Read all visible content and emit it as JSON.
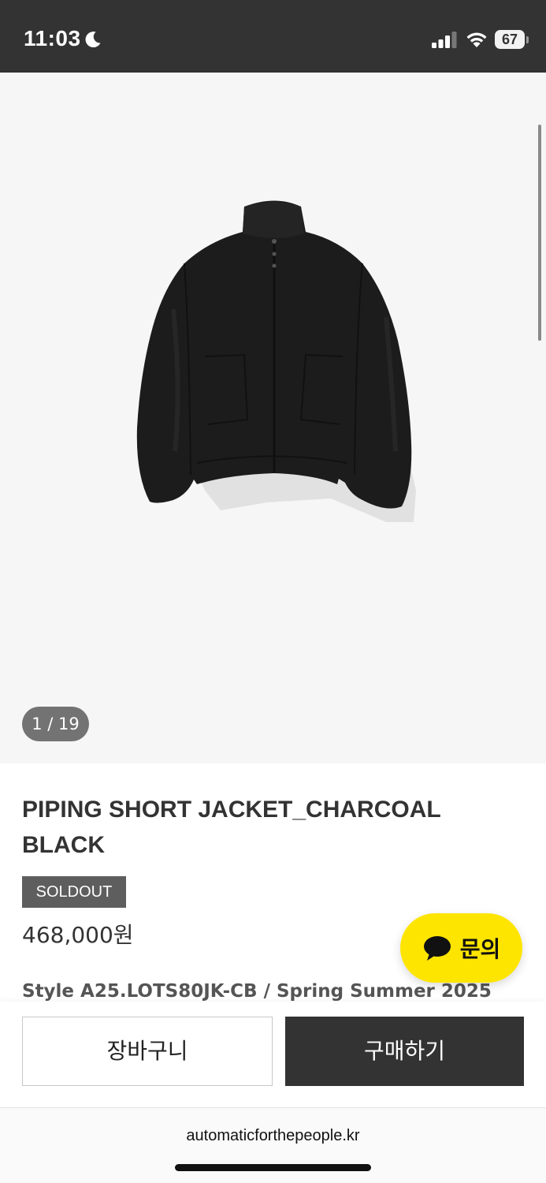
{
  "status_bar": {
    "time": "11:03",
    "battery": "67",
    "icons": [
      "moon-icon",
      "signal-icon",
      "wifi-icon",
      "battery-icon"
    ]
  },
  "gallery": {
    "counter": "1 / 19",
    "image": "black-jacket-product-photo"
  },
  "product": {
    "title": "PIPING SHORT JACKET_CHARCOAL BLACK",
    "badge": "SOLDOUT",
    "price": "468,000원",
    "style_info": "Style A25.LOTS80JK-CB / Spring Summer 2025"
  },
  "inquiry": {
    "label": "문의",
    "icon": "chat-bubble-icon",
    "color": "#FEE500"
  },
  "actions": {
    "cart_label": "장바구니",
    "buy_label": "구매하기"
  },
  "browser": {
    "url": "automaticforthepeople.kr"
  },
  "colors": {
    "status_bar_bg": "#333333",
    "buy_button_bg": "#333333",
    "badge_bg": "#5E5E5E",
    "gallery_bg": "#F6F6F6"
  }
}
